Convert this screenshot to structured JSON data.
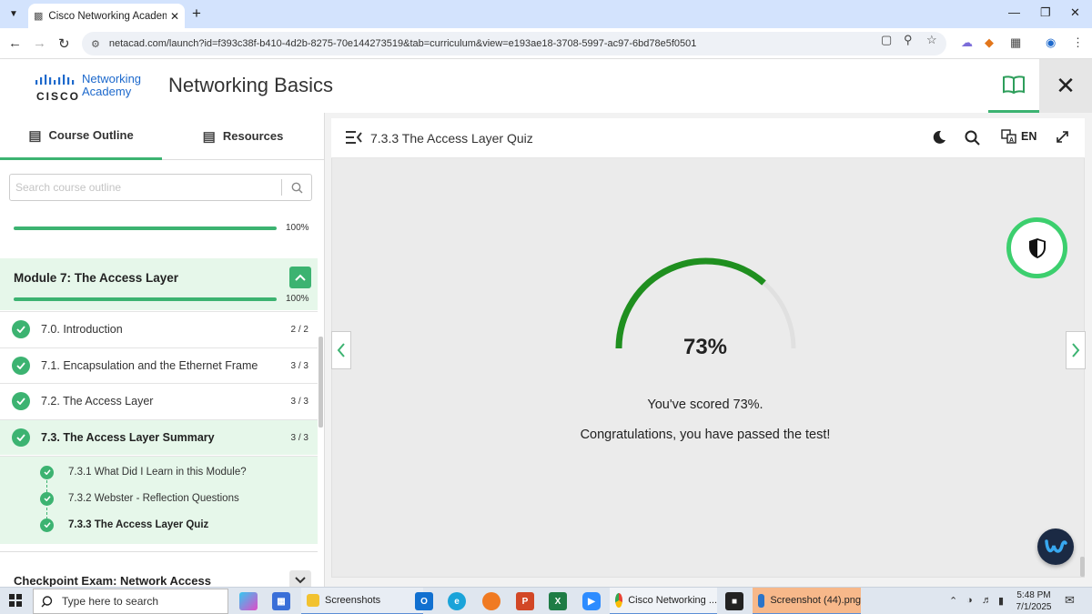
{
  "browser": {
    "tab_title": "Cisco Networking Academy: Co",
    "url": "netacad.com/launch?id=f393c38f-b410-4d2b-8275-70e144273519&tab=curriculum&view=e193ae18-3708-5997-ac97-6bd78e5f0501"
  },
  "header": {
    "logo_word": "CISCO",
    "logo_line1": "Networking",
    "logo_line2": "Academy",
    "title": "Networking Basics"
  },
  "sidebar": {
    "tabs": [
      {
        "label": "Course Outline",
        "icon": "outline-icon"
      },
      {
        "label": "Resources",
        "icon": "document-icon"
      }
    ],
    "search_placeholder": "Search course outline",
    "prev_progress": {
      "label": "100%",
      "value": 100
    },
    "module": {
      "title": "Module 7: The Access Layer",
      "progress_label": "100%",
      "progress": 100,
      "lessons": [
        {
          "title": "7.0. Introduction",
          "count": "2 / 2"
        },
        {
          "title": "7.1. Encapsulation and the Ethernet Frame",
          "count": "3 / 3"
        },
        {
          "title": "7.2. The Access Layer",
          "count": "3 / 3"
        },
        {
          "title": "7.3. The Access Layer Summary",
          "count": "3 / 3"
        }
      ],
      "subtopics": [
        {
          "title": "7.3.1 What Did I Learn in this Module?"
        },
        {
          "title": "7.3.2 Webster - Reflection Questions"
        },
        {
          "title": "7.3.3 The Access Layer Quiz"
        }
      ]
    },
    "checkpoint_title": "Checkpoint Exam: Network Access"
  },
  "content": {
    "title": "7.3.3 The Access Layer Quiz",
    "language": "EN",
    "score_percent": 73,
    "score_label": "73%",
    "score_text": "You've scored 73%.",
    "pass_text": "Congratulations, you have passed the test!"
  },
  "taskbar": {
    "search_placeholder": "Type here to search",
    "items": [
      {
        "label": "Screenshots"
      },
      {
        "label": "Cisco Networking ..."
      },
      {
        "label": "Screenshot (44).png"
      }
    ],
    "time": "5:48 PM",
    "date": "7/1/2025"
  },
  "colors": {
    "accent_green": "#3cb371",
    "gauge_green": "#1f8f1f",
    "link_blue": "#1d69cc"
  }
}
